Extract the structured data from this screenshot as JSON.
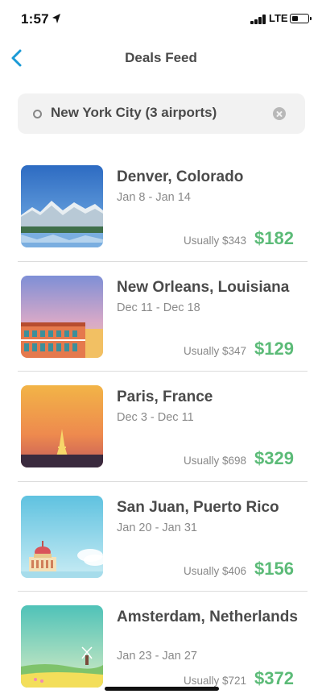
{
  "status_bar": {
    "time": "1:57",
    "network": "LTE"
  },
  "nav": {
    "title": "Deals Feed"
  },
  "search": {
    "value": "New York City (3 airports)"
  },
  "deals": [
    {
      "city": "Denver, Colorado",
      "dates": "Jan 8 - Jan 14",
      "usual": "Usually $343",
      "price": "$182",
      "image": "mountain-lake"
    },
    {
      "city": "New Orleans, Louisiana",
      "dates": "Dec 11 - Dec 18",
      "usual": "Usually $347",
      "price": "$129",
      "image": "french-quarter-buildings"
    },
    {
      "city": "Paris, France",
      "dates": "Dec 3 - Dec 11",
      "usual": "Usually $698",
      "price": "$329",
      "image": "eiffel-tower-sunset"
    },
    {
      "city": "San Juan, Puerto Rico",
      "dates": "Jan 20 - Jan 31",
      "usual": "Usually $406",
      "price": "$156",
      "image": "capitol-building"
    },
    {
      "city": "Amsterdam, Netherlands",
      "dates": "Jan 23 - Jan 27",
      "usual": "Usually $721",
      "price": "$372",
      "image": "windmill-field"
    }
  ],
  "colors": {
    "accent": "#1a9ad6",
    "price": "#5cbb78"
  }
}
